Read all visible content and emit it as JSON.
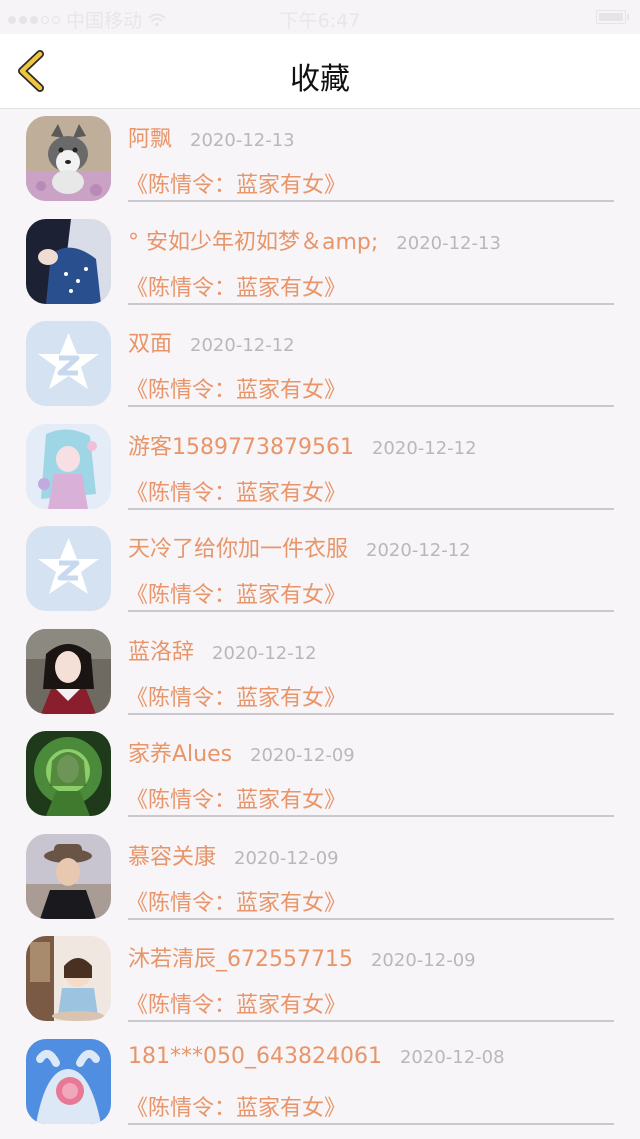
{
  "status_bar": {
    "carrier": "中国移动",
    "time": "下午6:47"
  },
  "nav": {
    "title": "收藏",
    "back_icon": "chevron-left-icon",
    "accent_color": "#f0c640"
  },
  "items": [
    {
      "username": "阿飘",
      "date": "2020-12-13",
      "title": "《陈情令：蓝家有女》",
      "avatar": "husky-dog-photo"
    },
    {
      "username": "° 安如少年初如梦＆amp;",
      "date": "2020-12-13",
      "title": "《陈情令：蓝家有女》",
      "avatar": "dark-haired-girl-photo"
    },
    {
      "username": "双面",
      "date": "2020-12-12",
      "title": "《陈情令：蓝家有女》",
      "avatar": "default-qq-avatar"
    },
    {
      "username": "游客1589773879561",
      "date": "2020-12-12",
      "title": "《陈情令：蓝家有女》",
      "avatar": "anime-girl-illustration"
    },
    {
      "username": "天冷了给你加一件衣服",
      "date": "2020-12-12",
      "title": "《陈情令：蓝家有女》",
      "avatar": "default-qq-avatar"
    },
    {
      "username": "蓝洛辞",
      "date": "2020-12-12",
      "title": "《陈情令：蓝家有女》",
      "avatar": "woman-portrait-photo"
    },
    {
      "username": "家养Alues",
      "date": "2020-12-09",
      "title": "《陈情令：蓝家有女》",
      "avatar": "green-glow-portrait"
    },
    {
      "username": "慕容关康",
      "date": "2020-12-09",
      "title": "《陈情令：蓝家有女》",
      "avatar": "man-with-hat-photo"
    },
    {
      "username": "沐若清辰_672557715",
      "date": "2020-12-09",
      "title": "《陈情令：蓝家有女》",
      "avatar": "chibi-anime-illustration"
    },
    {
      "username": "181***050_643824061",
      "date": "2020-12-08",
      "title": "《陈情令：蓝家有女》",
      "avatar": "blue-anime-illustration"
    }
  ],
  "colors": {
    "username": "#e8956a",
    "date": "#b8b8bc",
    "background": "#f7f5f7"
  }
}
